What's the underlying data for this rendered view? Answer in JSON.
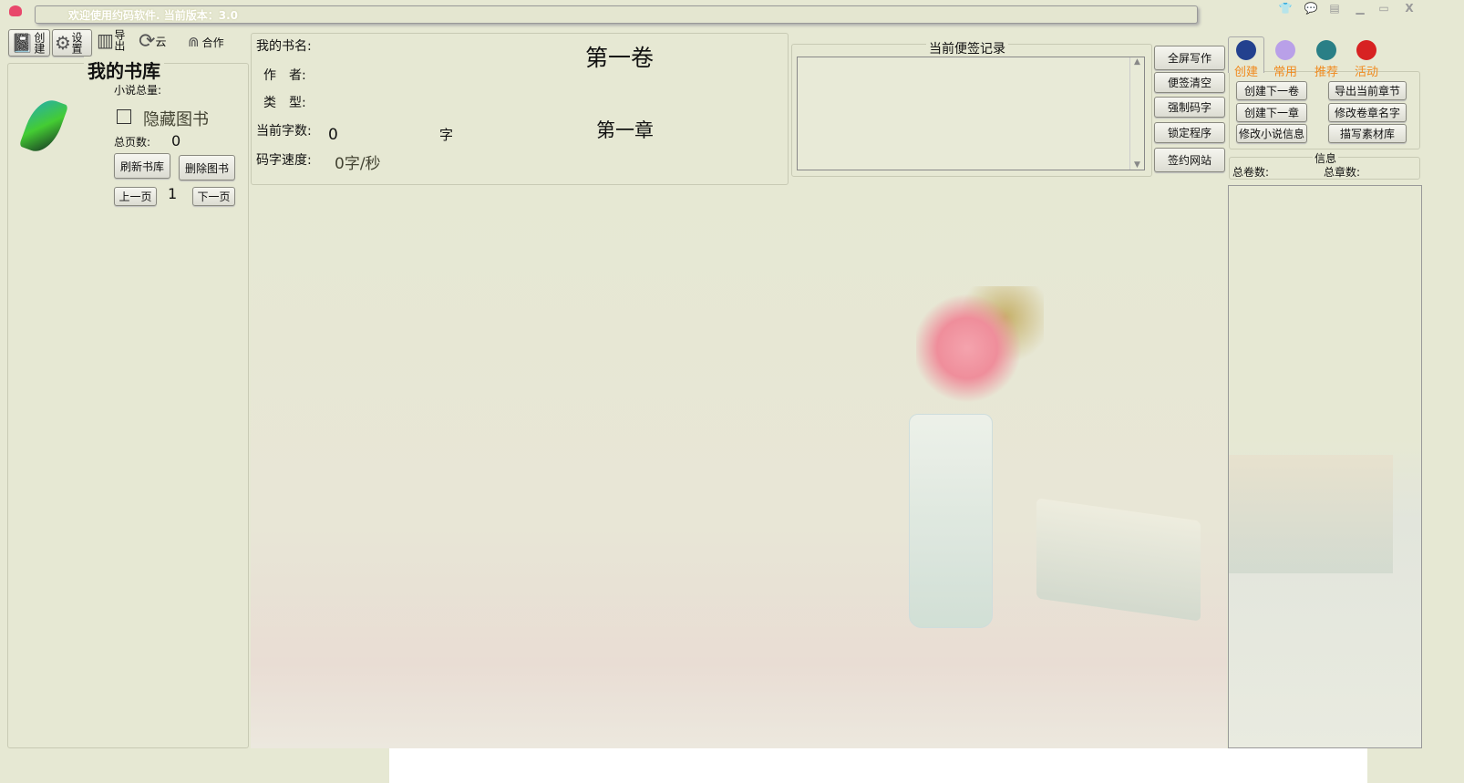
{
  "title": "欢迎使用约码软件. 当前版本：3.0",
  "window_controls": [
    "shirt-icon",
    "chat-icon",
    "menu-icon",
    "minimize-icon",
    "maximize-icon",
    "close-icon"
  ],
  "toolbar": [
    {
      "label": "创建",
      "icon": "notebook-icon"
    },
    {
      "label": "设置",
      "icon": "gear-icon"
    },
    {
      "label": "导出",
      "icon": "export-icon"
    },
    {
      "label": "云",
      "icon": "sync-icon"
    },
    {
      "label": "合作",
      "icon": "people-icon"
    }
  ],
  "library": {
    "title": "我的书库",
    "total_label": "小说总量:",
    "hide_label": "隐藏图书",
    "hide_checked": false,
    "pages_label": "总页数:",
    "pages_value": "0",
    "refresh": "刷新书库",
    "delete": "删除图书",
    "prev": "上一页",
    "page": "1",
    "next": "下一页"
  },
  "info": {
    "book_name": "我的书名:",
    "author": "作　者:",
    "type": "类　型:",
    "word_count_label": "当前字数:",
    "word_count": "0",
    "word_unit": "字",
    "speed_label": "码字速度:",
    "speed": "0字/秒",
    "volume": "第一卷",
    "chapter": "第一章"
  },
  "notes": {
    "title": "当前便签记录",
    "text": ""
  },
  "side_buttons": [
    "全屏写作",
    "便签清空",
    "强制码字",
    "锁定程序",
    "签约网站"
  ],
  "tabs": [
    "创建",
    "常用",
    "推荐",
    "活动"
  ],
  "create_buttons": [
    "创建下一卷",
    "导出当前章节",
    "创建下一章",
    "修改卷章名字",
    "修改小说信息",
    "描写素材库"
  ],
  "stats": {
    "title": "信息",
    "volumes": "总卷数:",
    "chapters": "总章数:"
  }
}
